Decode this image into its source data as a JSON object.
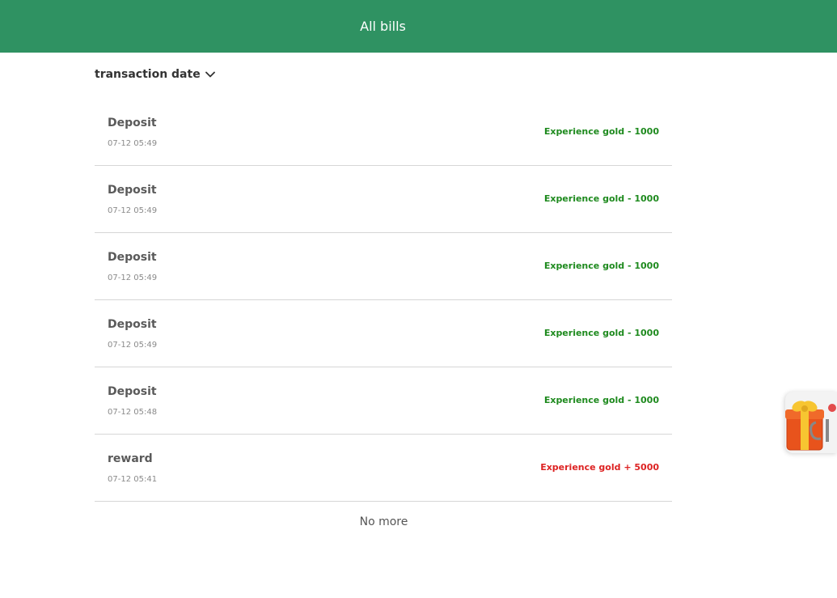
{
  "header": {
    "title": "All bills"
  },
  "filter": {
    "label": "transaction date"
  },
  "transactions": [
    {
      "title": "Deposit",
      "time": "07-12 05:49",
      "amount": "Experience gold - 1000",
      "color": "#1e8a1e"
    },
    {
      "title": "Deposit",
      "time": "07-12 05:49",
      "amount": "Experience gold - 1000",
      "color": "#1e8a1e"
    },
    {
      "title": "Deposit",
      "time": "07-12 05:49",
      "amount": "Experience gold - 1000",
      "color": "#1e8a1e"
    },
    {
      "title": "Deposit",
      "time": "07-12 05:49",
      "amount": "Experience gold - 1000",
      "color": "#1e8a1e"
    },
    {
      "title": "Deposit",
      "time": "07-12 05:48",
      "amount": "Experience gold - 1000",
      "color": "#1e8a1e"
    },
    {
      "title": "reward",
      "time": "07-12 05:41",
      "amount": "Experience gold + 5000",
      "color": "#dd2222"
    }
  ],
  "footer": {
    "text": "No more"
  },
  "colors": {
    "header_bg": "#2f9262",
    "deduct": "#1e8a1e",
    "credit": "#dd2222"
  },
  "icons": {
    "filter_toggle": "chevron-down-icon",
    "floating_widget": "gift-box-icon"
  }
}
